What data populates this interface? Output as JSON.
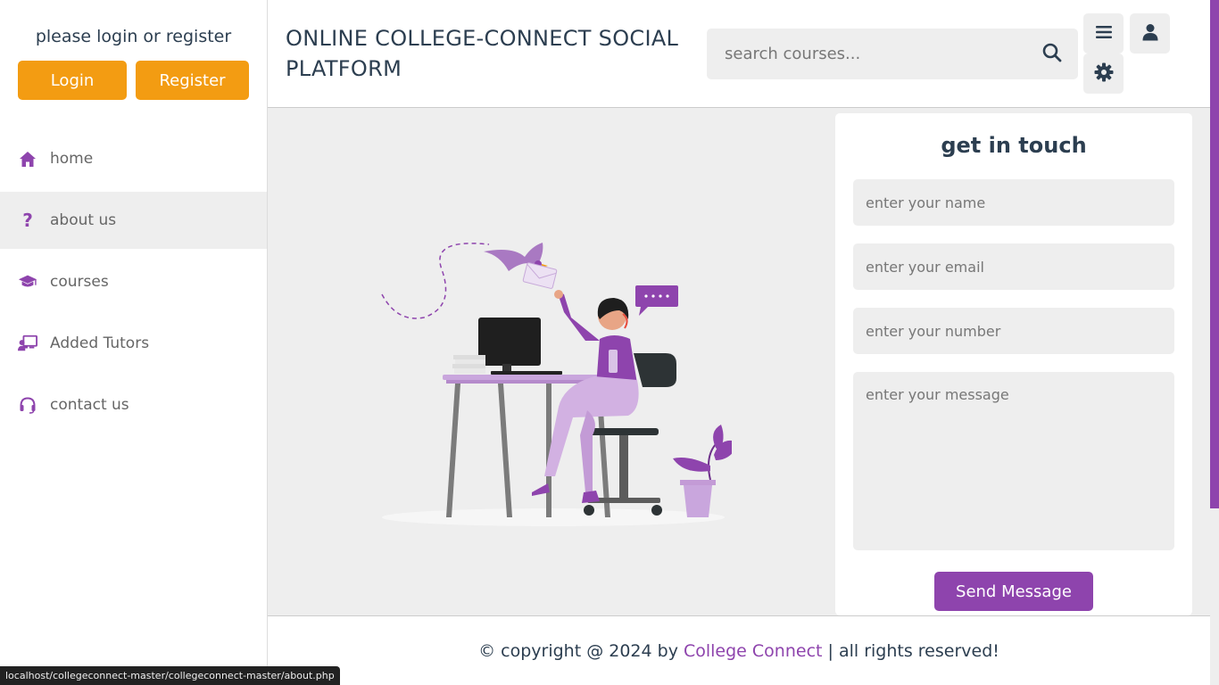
{
  "sidebar": {
    "profile_text": "please login or register",
    "login_label": "Login",
    "register_label": "Register",
    "items": [
      {
        "label": "home",
        "icon": "home-icon"
      },
      {
        "label": "about us",
        "icon": "question-icon",
        "active": true
      },
      {
        "label": "courses",
        "icon": "graduation-cap-icon"
      },
      {
        "label": "Added Tutors",
        "icon": "chalkboard-teacher-icon"
      },
      {
        "label": "contact us",
        "icon": "headset-icon"
      }
    ]
  },
  "header": {
    "brand": "ONLINE COLLEGE-CONNECT SOCIAL PLATFORM",
    "search_placeholder": "search courses...",
    "menu_icon": "bars-icon",
    "user_icon": "user-icon",
    "theme_icon": "gear-icon"
  },
  "contact_form": {
    "title": "get in touch",
    "name_placeholder": "enter your name",
    "email_placeholder": "enter your email",
    "number_placeholder": "enter your number",
    "message_placeholder": "enter your message",
    "send_label": "Send Message"
  },
  "footer": {
    "prefix": "© copyright @ 2024 by ",
    "brand": "College Connect",
    "suffix": " | all rights reserved!"
  },
  "status_bar": {
    "url": "localhost/collegeconnect-master/collegeconnect-master/about.php"
  },
  "colors": {
    "accent": "#8e44ad",
    "orange": "#f39c12",
    "text": "#2c3e50",
    "bg": "#eeeeee"
  }
}
